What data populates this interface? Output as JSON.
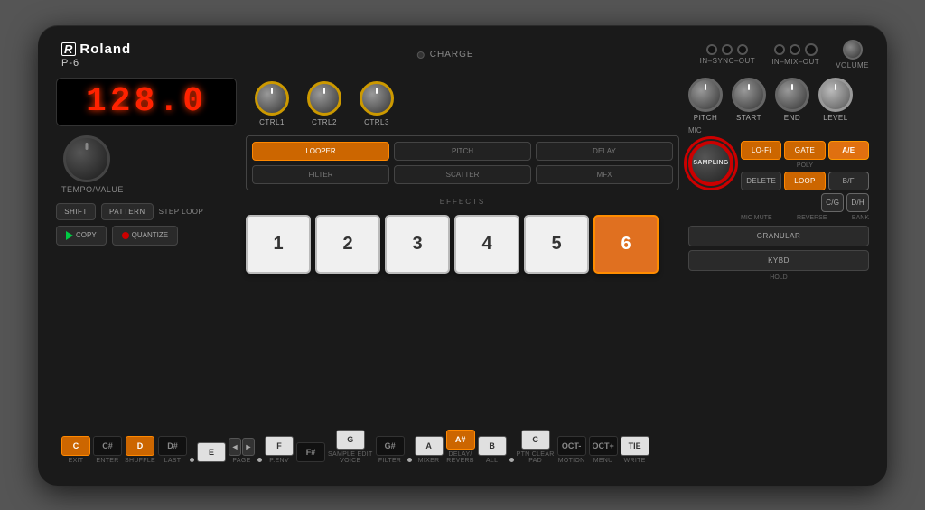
{
  "device": {
    "brand": "Roland",
    "model": "P-6",
    "display": "128.0",
    "charge_label": "CHARGE",
    "tempo_label": "TEMPO/VALUE",
    "ports": {
      "group1": "IN–SYNC–OUT",
      "group2": "IN–MIX–OUT",
      "volume": "VOLUME"
    },
    "ctrl_knobs": [
      "CTRL1",
      "CTRL2",
      "CTRL3"
    ],
    "effect_buttons": [
      {
        "label": "LOOPER",
        "sub": "",
        "active": true
      },
      {
        "label": "PITCH",
        "sub": "",
        "active": false
      },
      {
        "label": "DELAY",
        "sub": "",
        "active": false
      },
      {
        "label": "FILTER",
        "sub": "",
        "active": false
      },
      {
        "label": "SCATTER",
        "sub": "",
        "active": false
      },
      {
        "label": "MFX",
        "sub": "",
        "active": false
      }
    ],
    "effects_label": "EFFECTS",
    "pads": [
      "1",
      "2",
      "3",
      "4",
      "5",
      "6"
    ],
    "pitch_knobs": [
      "PITCH",
      "START",
      "END",
      "LEVEL"
    ],
    "mic_label": "MIC",
    "right_buttons": [
      {
        "label": "LO-Fi",
        "type": "orange"
      },
      {
        "label": "GATE",
        "type": "orange"
      },
      {
        "label": "A/E",
        "type": "ae"
      },
      {
        "label": "B/F",
        "type": "normal"
      },
      {
        "label": "DELETE",
        "type": "normal"
      },
      {
        "label": "LOOP",
        "type": "orange"
      },
      {
        "label": "C/G",
        "type": "normal"
      },
      {
        "label": "D/H",
        "type": "normal"
      }
    ],
    "poly_label": "POLY",
    "bank_label": "BANK",
    "mic_mute_label": "MIC MUTE",
    "reverse_label": "REVERSE",
    "sampling_label": "SAMPLING",
    "granular_label": "GRANULAR",
    "kybd_label": "KYBD",
    "hold_label": "HOLD",
    "left_buttons": [
      {
        "label": "SHIFT",
        "type": "normal"
      },
      {
        "label": "PATTERN",
        "type": "normal"
      },
      {
        "label": "STEP LOOP",
        "type": "label"
      }
    ],
    "copy_label": "COPY",
    "quantize_label": "QUANTIZE",
    "keyboard_keys": [
      {
        "note": "C",
        "type": "orange",
        "bottom": "EXIT",
        "dot": "orange"
      },
      {
        "note": "C#",
        "type": "black",
        "bottom": "ENTER",
        "dot": "none"
      },
      {
        "note": "D",
        "type": "orange",
        "bottom": "SHUFFLE",
        "dot": "orange"
      },
      {
        "note": "D#",
        "type": "black",
        "bottom": "LAST",
        "dot": "none"
      },
      {
        "note": "E",
        "type": "white",
        "bottom": "",
        "dot": "white"
      },
      {
        "note": "◄",
        "type": "arrow-left",
        "bottom": "PAGE",
        "dot": "none"
      },
      {
        "note": "►",
        "type": "arrow-right",
        "bottom": "",
        "dot": "none"
      },
      {
        "note": "F",
        "type": "white",
        "bottom": "P.ENV",
        "dot": "white"
      },
      {
        "note": "F#",
        "type": "black",
        "bottom": "",
        "dot": "none"
      },
      {
        "note": "G",
        "type": "white",
        "bottom": "SAMPLE EDIT\nVOICE",
        "dot": "white"
      },
      {
        "note": "G#",
        "type": "black",
        "bottom": "FILTER",
        "dot": "none"
      },
      {
        "note": "A",
        "type": "white",
        "bottom": "MIXER",
        "dot": "none"
      },
      {
        "note": "A#",
        "type": "orange",
        "bottom": "DELAY/\nREVERB",
        "dot": "orange"
      },
      {
        "note": "B",
        "type": "white",
        "bottom": "ALL",
        "dot": "none"
      },
      {
        "note": "C",
        "type": "white",
        "bottom": "PTN CLEAR\nPAD",
        "dot": "white"
      },
      {
        "note": "OCT-",
        "type": "black",
        "bottom": "MOTION",
        "dot": "none"
      },
      {
        "note": "OCT+",
        "type": "black",
        "bottom": "MENU",
        "dot": "none"
      },
      {
        "note": "TIE",
        "type": "white",
        "bottom": "WRITE",
        "dot": "none"
      }
    ]
  }
}
